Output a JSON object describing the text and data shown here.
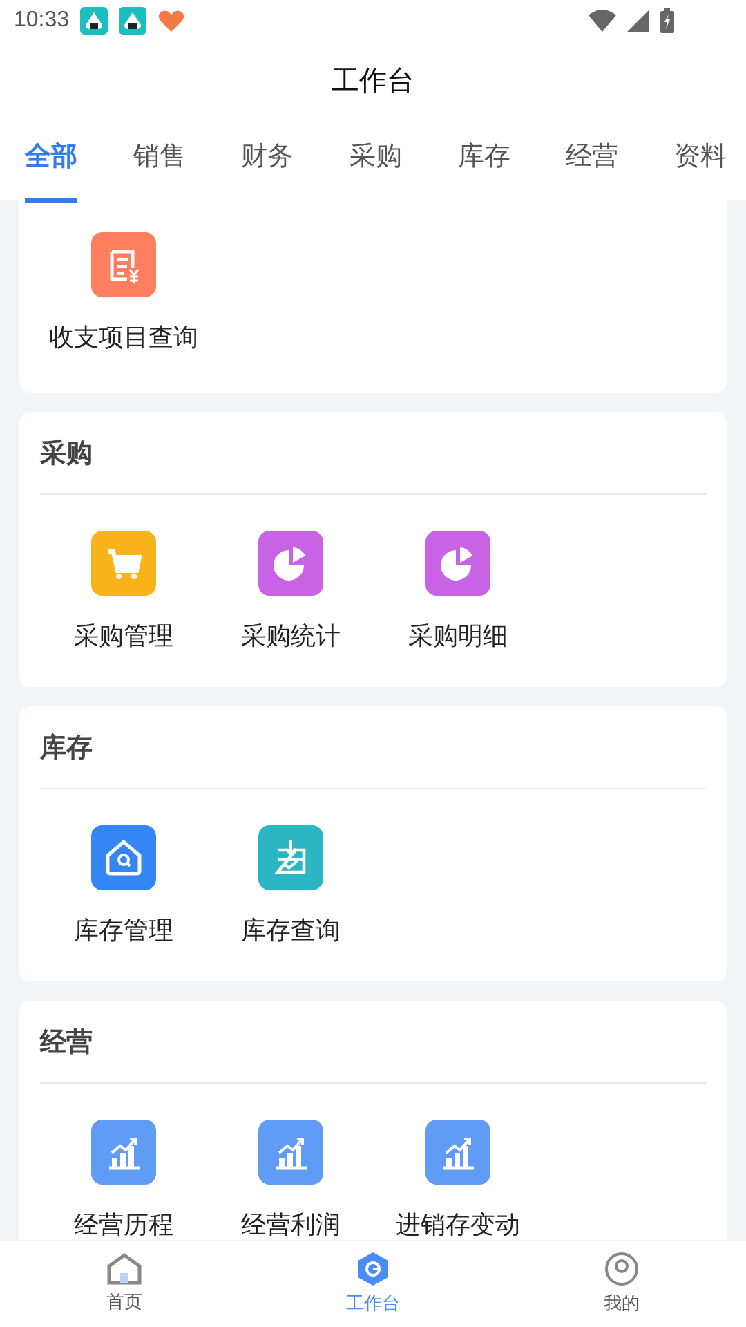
{
  "status_bar": {
    "time": "10:33"
  },
  "header": {
    "title": "工作台"
  },
  "tabs": [
    {
      "label": "全部",
      "selected": true
    },
    {
      "label": "销售",
      "selected": false
    },
    {
      "label": "财务",
      "selected": false
    },
    {
      "label": "采购",
      "selected": false
    },
    {
      "label": "库存",
      "selected": false
    },
    {
      "label": "经营",
      "selected": false
    },
    {
      "label": "资料",
      "selected": false
    }
  ],
  "sections": [
    {
      "items": [
        {
          "label": "收支项目查询",
          "kind": "bill",
          "color": "#fe7e60"
        }
      ]
    },
    {
      "title": "采购",
      "items": [
        {
          "label": "采购管理",
          "kind": "cart",
          "color": "#f8b41a"
        },
        {
          "label": "采购统计",
          "kind": "pie",
          "color": "#c963e5"
        },
        {
          "label": "采购明细",
          "kind": "pie",
          "color": "#c963e5"
        }
      ]
    },
    {
      "title": "库存",
      "items": [
        {
          "label": "库存管理",
          "kind": "house",
          "color": "#3485f5"
        },
        {
          "label": "库存查询",
          "kind": "inbox",
          "color": "#2cb6c4"
        }
      ]
    },
    {
      "title": "经营",
      "items": [
        {
          "label": "经营历程",
          "kind": "chart",
          "color": "#609cf6"
        },
        {
          "label": "经营利润",
          "kind": "chart",
          "color": "#609cf6"
        },
        {
          "label": "进销存变动",
          "kind": "chart",
          "color": "#609cf6"
        }
      ]
    }
  ],
  "bottom_nav": [
    {
      "label": "首页",
      "kind": "home",
      "selected": false
    },
    {
      "label": "工作台",
      "kind": "hex",
      "selected": true
    },
    {
      "label": "我的",
      "kind": "person",
      "selected": false
    }
  ]
}
